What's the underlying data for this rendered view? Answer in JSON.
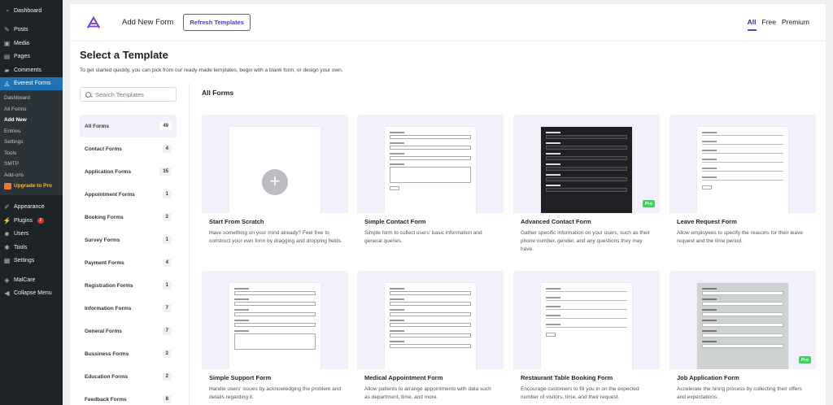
{
  "wp_sidebar": {
    "items_top": [
      {
        "label": "Dashboard",
        "icon": "dashboard-icon"
      },
      {
        "label": "Posts",
        "icon": "pin-icon"
      },
      {
        "label": "Media",
        "icon": "media-icon"
      },
      {
        "label": "Pages",
        "icon": "pages-icon"
      },
      {
        "label": "Comments",
        "icon": "comment-icon"
      },
      {
        "label": "Everest Forms",
        "icon": "everest-icon"
      }
    ],
    "submenu": [
      "Dashboard",
      "All Forms",
      "Add New",
      "Entries",
      "Settings",
      "Tools",
      "SMTP",
      "Add-ons"
    ],
    "upgrade_label": "Upgrade to Pro",
    "items_bottom": [
      {
        "label": "Appearance",
        "icon": "brush-icon"
      },
      {
        "label": "Plugins",
        "icon": "plug-icon",
        "badge": "2"
      },
      {
        "label": "Users",
        "icon": "user-icon"
      },
      {
        "label": "Tools",
        "icon": "wrench-icon"
      },
      {
        "label": "Settings",
        "icon": "settings-icon"
      }
    ],
    "items_extra": [
      {
        "label": "MalCare",
        "icon": "shield-icon"
      },
      {
        "label": "Collapse Menu",
        "icon": "collapse-icon"
      }
    ]
  },
  "header": {
    "add_new_form": "Add New Form",
    "refresh_button": "Refresh Templates",
    "filter_tabs": [
      "All",
      "Free",
      "Premium"
    ]
  },
  "page": {
    "title": "Select a Template",
    "description": "To get started quickly, you can pick from our ready-made templates, begin with a blank form, or design your own."
  },
  "search": {
    "placeholder": "Search Templates"
  },
  "categories": [
    {
      "label": "All Forms",
      "count": "49"
    },
    {
      "label": "Contact Forms",
      "count": "4"
    },
    {
      "label": "Application Forms",
      "count": "15"
    },
    {
      "label": "Appointment Forms",
      "count": "1"
    },
    {
      "label": "Booking Forms",
      "count": "2"
    },
    {
      "label": "Survey Forms",
      "count": "1"
    },
    {
      "label": "Payment Forms",
      "count": "4"
    },
    {
      "label": "Registration Forms",
      "count": "1"
    },
    {
      "label": "Information Forms",
      "count": "7"
    },
    {
      "label": "General Forms",
      "count": "7"
    },
    {
      "label": "Bussiness Forms",
      "count": "2"
    },
    {
      "label": "Education Forms",
      "count": "2"
    },
    {
      "label": "Feedback Forms",
      "count": "8"
    }
  ],
  "section_title": "All Forms",
  "templates": [
    {
      "title": "Start From Scratch",
      "desc": "Have something on your mind already? Feel free to construct your own form by dragging and dropping fields."
    },
    {
      "title": "Simple Contact Form",
      "desc": "Simple form to collect users' basic information and general queries."
    },
    {
      "title": "Advanced Contact Form",
      "desc": "Gather specific information on your users, such as their phone number, gender, and any questions they may have.",
      "pro": "Pro"
    },
    {
      "title": "Leave Request Form",
      "desc": "Allow employees to specify the reasons for their leave request and the time period."
    },
    {
      "title": "Simple Support Form",
      "desc": "Handle users' issues by acknowledging the problem and details regarding it."
    },
    {
      "title": "Medical Appointment Form",
      "desc": "Allow patients to arrange appointments with data such as department, time, and more."
    },
    {
      "title": "Restaurant Table Booking Form",
      "desc": "Encourage customers to fill you in on the expected number of visitors, time, and their request."
    },
    {
      "title": "Job Application Form",
      "desc": "Accelerate the hiring process by collecting their offers and expectations.",
      "pro": "Pro"
    }
  ]
}
